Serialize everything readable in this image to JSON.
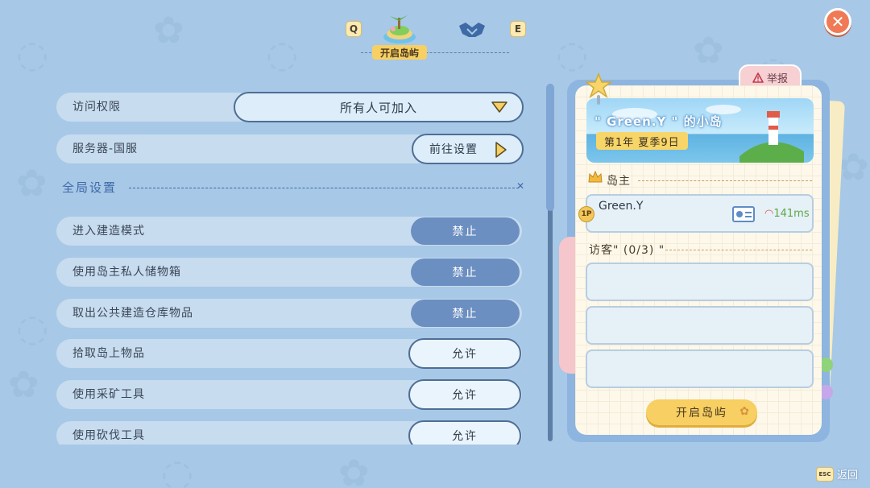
{
  "tabs": {
    "prev_key": "Q",
    "next_key": "E",
    "active_label": "开启岛屿"
  },
  "settings": {
    "access": {
      "label": "访问权限",
      "value": "所有人可加入"
    },
    "server": {
      "label": "服务器-国服",
      "button": "前往设置"
    },
    "section_title": "全局设置",
    "permissions": [
      {
        "label": "进入建造模式",
        "value": "禁止",
        "state": "off"
      },
      {
        "label": "使用岛主私人储物箱",
        "value": "禁止",
        "state": "off"
      },
      {
        "label": "取出公共建造仓库物品",
        "value": "禁止",
        "state": "off"
      },
      {
        "label": "拾取岛上物品",
        "value": "允许",
        "state": "on"
      },
      {
        "label": "使用采矿工具",
        "value": "允许",
        "state": "on"
      },
      {
        "label": "使用砍伐工具",
        "value": "允许",
        "state": "on"
      }
    ]
  },
  "island_card": {
    "report_label": "举报",
    "island_name": "\" Green.Y \" 的小岛",
    "date": "第1年 夏季9日",
    "host_label": "岛主",
    "host": {
      "badge": "1P",
      "name": "Green.Y",
      "ping": "141ms"
    },
    "visitors_label": "访客\" (0/3) \"",
    "visitor_slots": 3,
    "open_button": "开启岛屿"
  },
  "footer": {
    "esc_key": "ESC",
    "back_label": "返回"
  },
  "colors": {
    "background": "#a7c8e6",
    "accent_yellow": "#f7cf62",
    "toggle_off": "#6c8fc2",
    "close_button": "#ef7a55"
  },
  "icons": {
    "tab_island": "island-icon",
    "tab_multiplayer": "handshake-icon",
    "close": "close-icon",
    "report": "warning-icon",
    "host": "crown-icon",
    "ping": "wifi-icon"
  }
}
